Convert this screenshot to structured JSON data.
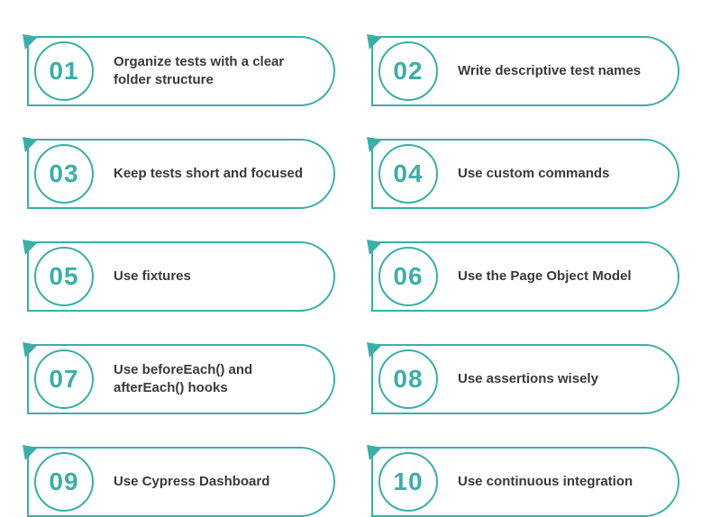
{
  "items": [
    {
      "num": "01",
      "text": "Organize tests with a clear folder structure"
    },
    {
      "num": "02",
      "text": "Write descriptive test names"
    },
    {
      "num": "03",
      "text": "Keep tests short and focused"
    },
    {
      "num": "04",
      "text": "Use custom commands"
    },
    {
      "num": "05",
      "text": "Use fixtures"
    },
    {
      "num": "06",
      "text": "Use the Page Object Model"
    },
    {
      "num": "07",
      "text": "Use beforeEach() and afterEach() hooks"
    },
    {
      "num": "08",
      "text": "Use assertions wisely"
    },
    {
      "num": "09",
      "text": "Use Cypress Dashboard"
    },
    {
      "num": "10",
      "text": "Use continuous integration"
    }
  ],
  "colors": {
    "accent": "#3aafa9",
    "text": "#3a3a3a",
    "bg": "#ffffff"
  }
}
